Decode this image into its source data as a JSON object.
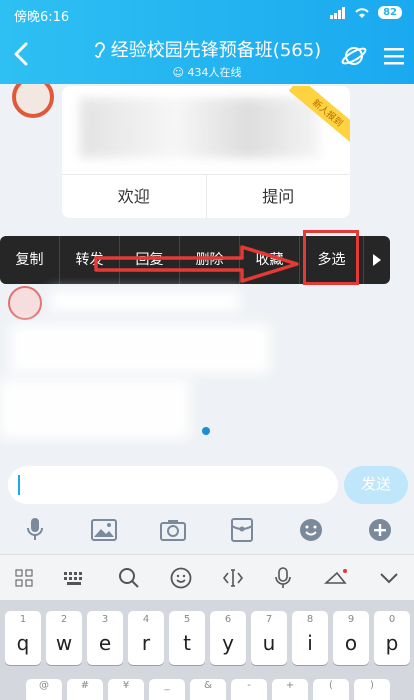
{
  "status": {
    "time": "傍晚6:16",
    "battery": "82"
  },
  "header": {
    "title": "经验校园先锋预备班(565)",
    "online": "434人在线"
  },
  "card": {
    "ribbon": "新人报到",
    "actions": [
      "欢迎",
      "提问"
    ]
  },
  "menu": {
    "items": [
      "复制",
      "转发",
      "回复",
      "删除",
      "收藏",
      "多选"
    ]
  },
  "input": {
    "value": "",
    "send_label": "发送"
  },
  "keyboard": {
    "row1": [
      "q",
      "w",
      "e",
      "r",
      "t",
      "y",
      "u",
      "i",
      "o",
      "p"
    ],
    "digits": [
      "1",
      "2",
      "3",
      "4",
      "5",
      "6",
      "7",
      "8",
      "9",
      "0"
    ],
    "row2_hints": [
      "@",
      "#",
      "¥",
      "_",
      "&",
      "-",
      "+",
      "(",
      ")"
    ]
  },
  "colors": {
    "header_start": "#2ec0f2",
    "header_end": "#1aa9f0",
    "highlight": "#e53935",
    "menu_bg": "#262626"
  }
}
